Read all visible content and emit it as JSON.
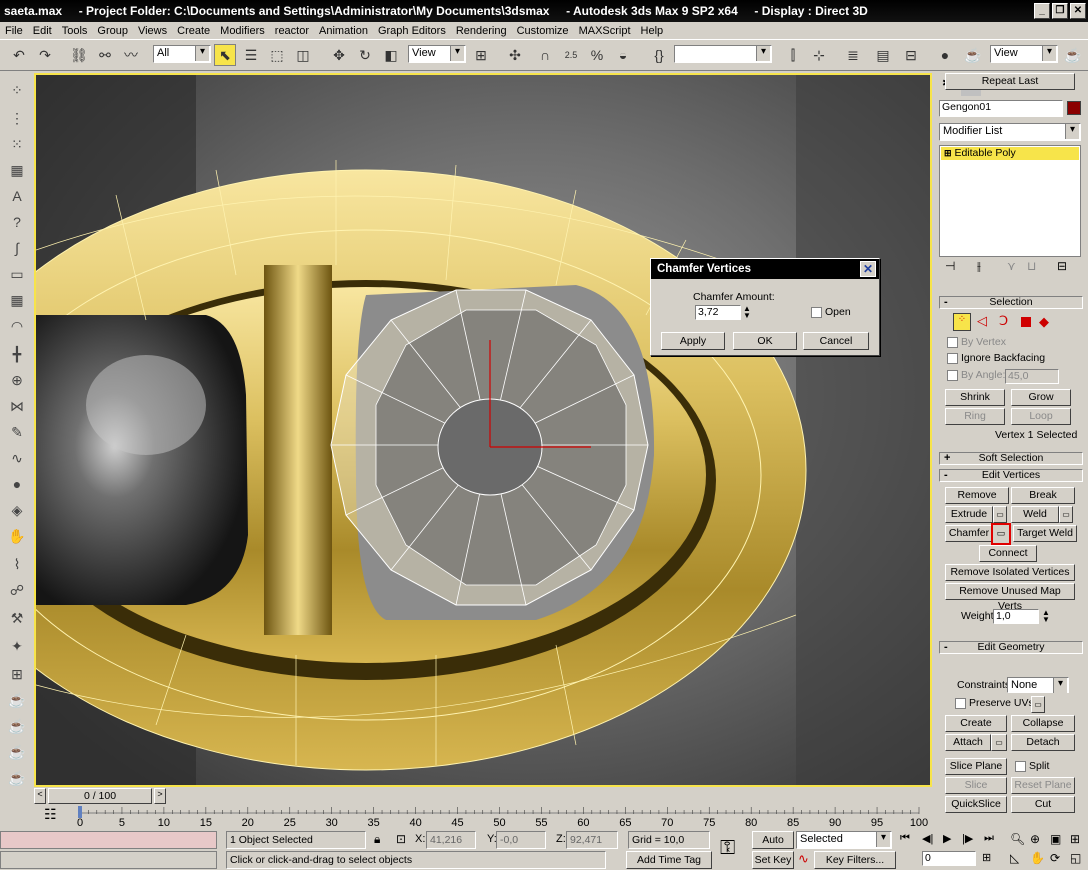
{
  "window": {
    "title": "saeta.max     - Project Folder: C:\\Documents and Settings\\Administrator\\My Documents\\3dsmax     - Autodesk 3ds Max 9 SP2 x64     - Display : Direct 3D"
  },
  "menu": [
    "File",
    "Edit",
    "Tools",
    "Group",
    "Views",
    "Create",
    "Modifiers",
    "reactor",
    "Animation",
    "Graph Editors",
    "Rendering",
    "Customize",
    "MAXScript",
    "Help"
  ],
  "toolbar": {
    "selection_filter": "All",
    "ref_coord": "View",
    "named_selection": "",
    "view_dropdown": "View",
    "angle_snap_label": "2.5"
  },
  "dialog": {
    "title": "Chamfer Vertices",
    "amount_label": "Chamfer Amount:",
    "amount_value": "3,72",
    "open_label": "Open",
    "apply": "Apply",
    "ok": "OK",
    "cancel": "Cancel"
  },
  "panel": {
    "object_name": "Gengon01",
    "object_color": "#8b0000",
    "modifier_list": "Modifier List",
    "stack_item": "Editable Poly",
    "selection": {
      "header": "Selection",
      "by_vertex": "By Vertex",
      "ignore_backfacing": "Ignore Backfacing",
      "by_angle": "By Angle:",
      "angle_value": "45,0",
      "shrink": "Shrink",
      "grow": "Grow",
      "ring": "Ring",
      "loop": "Loop",
      "status": "Vertex 1 Selected"
    },
    "soft_selection": "Soft Selection",
    "edit_vertices": {
      "header": "Edit Vertices",
      "remove": "Remove",
      "break": "Break",
      "extrude": "Extrude",
      "weld": "Weld",
      "chamfer": "Chamfer",
      "target_weld": "Target Weld",
      "connect": "Connect",
      "remove_isolated": "Remove Isolated Vertices",
      "remove_unused": "Remove Unused Map Verts",
      "weight_label": "Weight:",
      "weight_value": "1,0"
    },
    "edit_geometry": {
      "header": "Edit Geometry",
      "repeat_last": "Repeat Last",
      "constraints_label": "Constraints:",
      "constraints_value": "None",
      "preserve_uvs": "Preserve UVs",
      "create": "Create",
      "collapse": "Collapse",
      "attach": "Attach",
      "detach": "Detach",
      "slice_plane": "Slice Plane",
      "split": "Split",
      "slice": "Slice",
      "reset_plane": "Reset Plane",
      "quickslice": "QuickSlice",
      "cut": "Cut"
    }
  },
  "timeline": {
    "frame": "0 / 100",
    "ticks": [
      "0",
      "5",
      "10",
      "15",
      "20",
      "25",
      "30",
      "35",
      "40",
      "45",
      "50",
      "55",
      "60",
      "65",
      "70",
      "75",
      "80",
      "85",
      "90",
      "95",
      "100"
    ]
  },
  "status": {
    "selected": "1 Object Selected",
    "prompt": "Click or click-and-drag to select objects",
    "x_label": "X:",
    "x": "41,216",
    "y_label": "Y:",
    "y": "-0,0",
    "z_label": "Z:",
    "z": "92,471",
    "grid": "Grid = 10,0",
    "add_time_tag": "Add Time Tag",
    "auto_key": "Auto Key",
    "set_key": "Set Key",
    "key_mode": "Selected",
    "key_filters": "Key Filters...",
    "frame_field": "0"
  }
}
